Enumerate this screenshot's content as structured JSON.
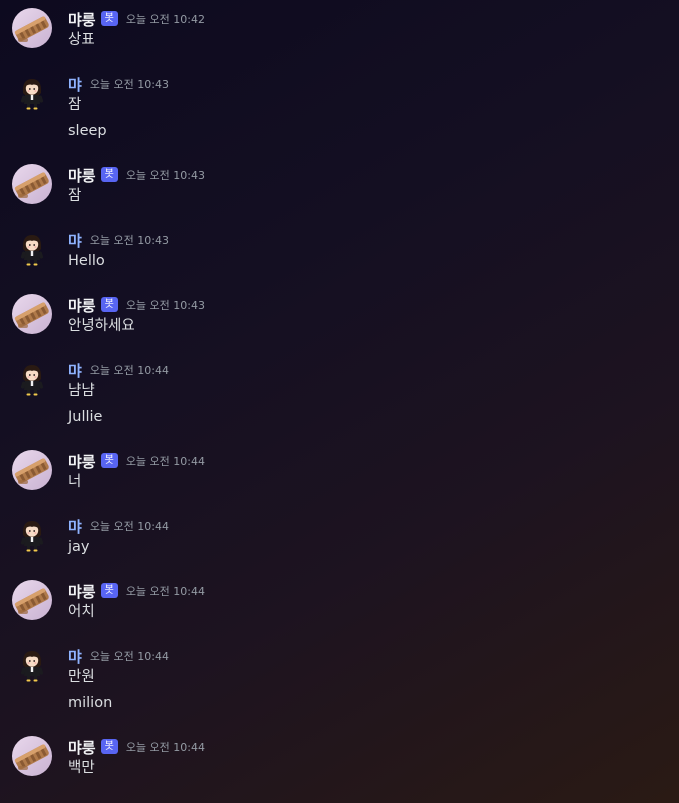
{
  "colors": {
    "bot_badge_bg": "#5865f2",
    "user_name": "#8fb3ff",
    "bot_name": "#f2f3f5",
    "timestamp": "#949ba4",
    "message_text": "#dbdee1"
  },
  "messages": [
    {
      "author": "먀룽",
      "bot": true,
      "badge": "봇",
      "time": "오늘 오전 10:42",
      "lines": [
        "상표"
      ]
    },
    {
      "author": "먀",
      "bot": false,
      "time": "오늘 오전 10:43",
      "lines": [
        "잠",
        "sleep"
      ]
    },
    {
      "author": "먀룽",
      "bot": true,
      "badge": "봇",
      "time": "오늘 오전 10:43",
      "lines": [
        "잠"
      ]
    },
    {
      "author": "먀",
      "bot": false,
      "time": "오늘 오전 10:43",
      "lines": [
        "Hello"
      ]
    },
    {
      "author": "먀룽",
      "bot": true,
      "badge": "봇",
      "time": "오늘 오전 10:43",
      "lines": [
        "안녕하세요"
      ]
    },
    {
      "author": "먀",
      "bot": false,
      "time": "오늘 오전 10:44",
      "lines": [
        "냠냠",
        "Jullie"
      ]
    },
    {
      "author": "먀룽",
      "bot": true,
      "badge": "봇",
      "time": "오늘 오전 10:44",
      "lines": [
        "너"
      ]
    },
    {
      "author": "먀",
      "bot": false,
      "time": "오늘 오전 10:44",
      "lines": [
        "jay"
      ]
    },
    {
      "author": "먀룽",
      "bot": true,
      "badge": "봇",
      "time": "오늘 오전 10:44",
      "lines": [
        "어치"
      ]
    },
    {
      "author": "먀",
      "bot": false,
      "time": "오늘 오전 10:44",
      "lines": [
        "만원",
        "milion"
      ]
    },
    {
      "author": "먀룽",
      "bot": true,
      "badge": "봇",
      "time": "오늘 오전 10:44",
      "lines": [
        "백만"
      ]
    }
  ]
}
